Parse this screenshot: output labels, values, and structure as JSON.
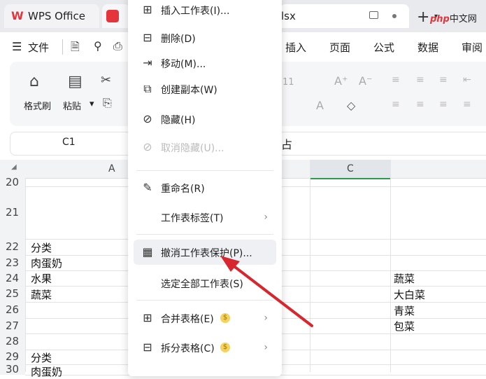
{
  "tabs": {
    "wps_label": "WPS Office",
    "file_suffix": "lsx"
  },
  "watermark": {
    "php": "php",
    "site": "中文网"
  },
  "menubar": {
    "file": "文件",
    "items": [
      "插入",
      "页面",
      "公式",
      "数据",
      "审阅"
    ]
  },
  "ribbon": {
    "format_painter": "格式刷",
    "paste": "粘贴",
    "font_size": "11"
  },
  "formula_bar": {
    "cell_ref": "C1",
    "content": "占"
  },
  "columns": [
    "A",
    "C"
  ],
  "rows": [
    {
      "num": "20",
      "a": "",
      "d": ""
    },
    {
      "num": "21",
      "a": "",
      "d": ""
    },
    {
      "num": "22",
      "a": "分类",
      "d": ""
    },
    {
      "num": "23",
      "a": "肉蛋奶",
      "d": ""
    },
    {
      "num": "24",
      "a": "水果",
      "d": "蔬菜"
    },
    {
      "num": "25",
      "a": "蔬菜",
      "d": "大白菜"
    },
    {
      "num": "26",
      "a": "",
      "d": "青菜"
    },
    {
      "num": "27",
      "a": "",
      "d": "包菜"
    },
    {
      "num": "28",
      "a": "",
      "d": ""
    },
    {
      "num": "29",
      "a": "分类",
      "d": ""
    },
    {
      "num": "30",
      "a": "肉蛋奶",
      "d": ""
    }
  ],
  "context_menu": {
    "insert": "插入工作表(I)...",
    "delete": "删除(D)",
    "move": "移动(M)...",
    "copy": "创建副本(W)",
    "hide": "隐藏(H)",
    "unhide": "取消隐藏(U)...",
    "rename": "重命名(R)",
    "tab_color": "工作表标签(T)",
    "unprotect": "撤消工作表保护(P)...",
    "select_all": "选定全部工作表(S)",
    "merge": "合并表格(E)",
    "split": "拆分表格(C)"
  },
  "colors": {
    "accent_red": "#e3353b",
    "arrow_red": "#d8262e",
    "col_select": "#2d9b4c"
  }
}
